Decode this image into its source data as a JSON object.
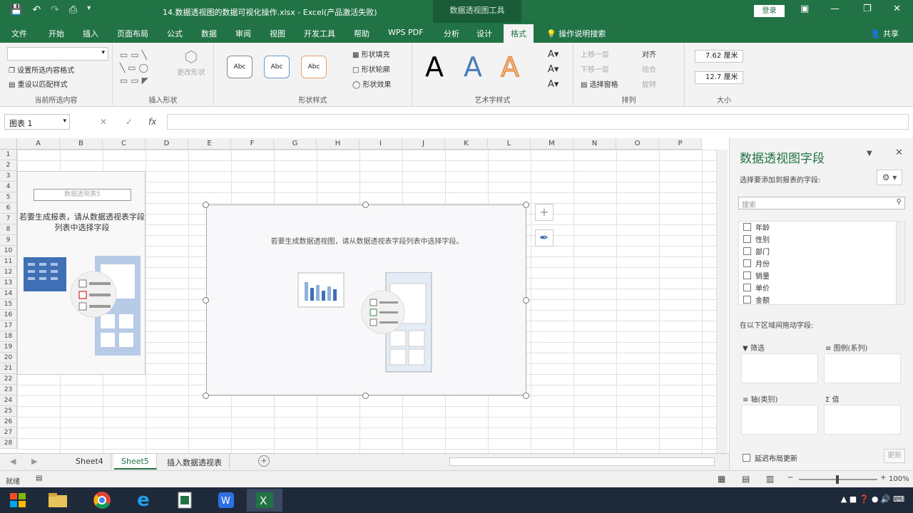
{
  "window": {
    "title": "14.数据透视图的数据可视化操作.xlsx  -  Excel(产品激活失败)",
    "context_header": "数据透视图工具",
    "login": "登录"
  },
  "tabs": [
    "文件",
    "开始",
    "插入",
    "页面布局",
    "公式",
    "数据",
    "审阅",
    "视图",
    "开发工具",
    "帮助",
    "WPS PDF",
    "分析",
    "设计",
    "格式"
  ],
  "tell_me": "操作说明搜索",
  "share": "共享",
  "ribbon": {
    "g1": {
      "label": "当前所选内容",
      "item1": "设置所选内容格式",
      "item2": "重设以匹配样式"
    },
    "g2": {
      "label": "插入形状",
      "item1": "更改形状"
    },
    "g3": {
      "label": "形状样式",
      "abc": "Abc",
      "fill": "形状填充",
      "outline": "形状轮廓",
      "effect": "形状效果"
    },
    "g4": {
      "label": "艺术字样式",
      "a": "A"
    },
    "g5": {
      "label": "排列",
      "up": "上移一层",
      "down": "下移一层",
      "pane": "选择窗格",
      "align": "对齐",
      "group": "组合",
      "rotate": "旋转"
    },
    "g6": {
      "label": "大小",
      "height": "7.62 厘米",
      "width": "12.7 厘米"
    }
  },
  "namebox": "图表 1",
  "columns": [
    "A",
    "B",
    "C",
    "D",
    "E",
    "F",
    "G",
    "H",
    "I",
    "J",
    "K",
    "L",
    "M",
    "N",
    "O",
    "P"
  ],
  "rows": [
    "1",
    "2",
    "3",
    "4",
    "5",
    "6",
    "7",
    "8",
    "9",
    "10",
    "11",
    "12",
    "13",
    "14",
    "15",
    "16",
    "17",
    "18",
    "19",
    "20",
    "21",
    "22",
    "23",
    "24",
    "25",
    "26",
    "27",
    "28"
  ],
  "pivot_placeholder": {
    "title": "数据透视表5",
    "msg": "若要生成报表，请从数据透视表字段列表中选择字段"
  },
  "chart": {
    "msg": "若要生成数据透视图，请从数据透视表字段列表中选择字段。"
  },
  "sheets": [
    "Sheet4",
    "Sheet5",
    "插入数据透视表"
  ],
  "status": {
    "ready": "就绪",
    "zoom": "100%"
  },
  "panel": {
    "title": "数据透视图字段",
    "sub": "选择要添加到报表的字段:",
    "search": "搜索",
    "fields": [
      "年龄",
      "性别",
      "部门",
      "月份",
      "销量",
      "单价",
      "金额"
    ],
    "drag_label": "在以下区域间拖动字段:",
    "filter": "筛选",
    "legend": "图例(系列)",
    "axis": "轴(类别)",
    "values": "值",
    "defer": "延迟布局更新",
    "update": "更新"
  },
  "colors": {
    "excel_green": "#217346",
    "panel_title": "#217346",
    "taskbar": "#1e2a3a"
  }
}
